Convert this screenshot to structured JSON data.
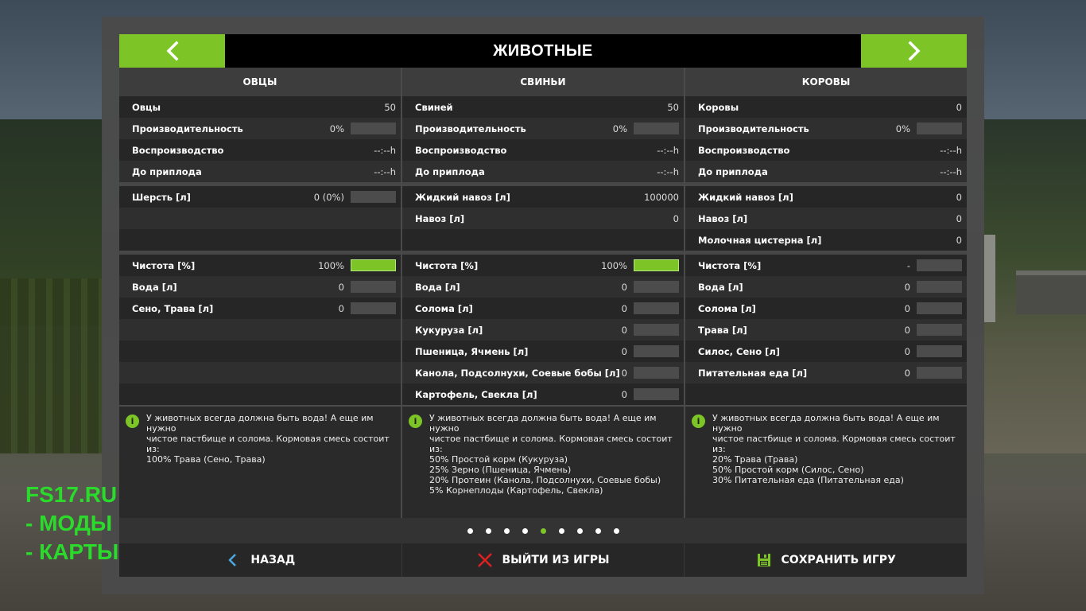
{
  "header": {
    "title": "ЖИВОТНЫЕ"
  },
  "columns": [
    {
      "name": "ОВЦЫ",
      "rows": [
        {
          "label": "Овцы",
          "value": "50",
          "bar": null
        },
        {
          "label": "Производительность",
          "value": "0%",
          "bar": 0
        },
        {
          "label": "Воспроизводство",
          "value": "--:--h",
          "bar": null
        },
        {
          "label": "До приплода",
          "value": "--:--h",
          "bar": null
        },
        {
          "sep": true
        },
        {
          "label": "Шерсть [л]",
          "value": "0 (0%)",
          "bar": 0
        },
        {
          "label": "",
          "value": "",
          "bar": null
        },
        {
          "label": "",
          "value": "",
          "bar": null
        },
        {
          "sep": true
        },
        {
          "label": "Чистота [%]",
          "value": "100%",
          "bar": 1
        },
        {
          "label": "Вода [л]",
          "value": "0",
          "bar": 0
        },
        {
          "label": "Сено, Трава [л]",
          "value": "0",
          "bar": 0
        },
        {
          "label": "",
          "value": "",
          "bar": null
        },
        {
          "label": "",
          "value": "",
          "bar": null
        },
        {
          "label": "",
          "value": "",
          "bar": null
        },
        {
          "label": "",
          "value": "",
          "bar": null
        }
      ],
      "info": "У животных всегда должна быть вода! А еще им нужно\nчистое пастбище и солома. Кормовая смесь состоит\nиз:\n100% Трава (Сено, Трава)"
    },
    {
      "name": "СВИНЬИ",
      "rows": [
        {
          "label": "Свиней",
          "value": "50",
          "bar": null
        },
        {
          "label": "Производительность",
          "value": "0%",
          "bar": 0
        },
        {
          "label": "Воспроизводство",
          "value": "--:--h",
          "bar": null
        },
        {
          "label": "До приплода",
          "value": "--:--h",
          "bar": null
        },
        {
          "sep": true
        },
        {
          "label": "Жидкий навоз [л]",
          "value": "100000",
          "bar": null
        },
        {
          "label": "Навоз [л]",
          "value": "0",
          "bar": null
        },
        {
          "label": "",
          "value": "",
          "bar": null
        },
        {
          "sep": true
        },
        {
          "label": "Чистота [%]",
          "value": "100%",
          "bar": 1
        },
        {
          "label": "Вода [л]",
          "value": "0",
          "bar": 0
        },
        {
          "label": "Солома [л]",
          "value": "0",
          "bar": 0
        },
        {
          "label": "Кукуруза [л]",
          "value": "0",
          "bar": 0
        },
        {
          "label": "Пшеница, Ячмень [л]",
          "value": "0",
          "bar": 0
        },
        {
          "label": "Канола, Подсолнухи, Соевые бобы [л]",
          "value": "0",
          "bar": 0
        },
        {
          "label": "Картофель, Свекла [л]",
          "value": "0",
          "bar": 0
        }
      ],
      "info": "У животных всегда должна быть вода! А еще им нужно\nчистое пастбище и солома. Кормовая смесь состоит\nиз:\n50% Простой корм (Кукуруза)\n25% Зерно (Пшеница, Ячмень)\n20% Протеин (Канола, Подсолнухи, Соевые бобы)\n5% Корнеплоды (Картофель, Свекла)"
    },
    {
      "name": "КОРОВЫ",
      "rows": [
        {
          "label": "Коровы",
          "value": "0",
          "bar": null
        },
        {
          "label": "Производительность",
          "value": "0%",
          "bar": 0
        },
        {
          "label": "Воспроизводство",
          "value": "--:--h",
          "bar": null
        },
        {
          "label": "До приплода",
          "value": "--:--h",
          "bar": null
        },
        {
          "sep": true
        },
        {
          "label": "Жидкий навоз [л]",
          "value": "0",
          "bar": null
        },
        {
          "label": "Навоз [л]",
          "value": "0",
          "bar": null
        },
        {
          "label": "Молочная цистерна [л]",
          "value": "0",
          "bar": null
        },
        {
          "sep": true
        },
        {
          "label": "Чистота [%]",
          "value": "-",
          "bar": 0
        },
        {
          "label": "Вода [л]",
          "value": "0",
          "bar": 0
        },
        {
          "label": "Солома [л]",
          "value": "0",
          "bar": 0
        },
        {
          "label": "Трава [л]",
          "value": "0",
          "bar": 0
        },
        {
          "label": "Силос, Сено [л]",
          "value": "0",
          "bar": 0
        },
        {
          "label": "Питательная еда [л]",
          "value": "0",
          "bar": 0
        },
        {
          "label": "",
          "value": "",
          "bar": null
        }
      ],
      "info": "У животных всегда должна быть вода! А еще им нужно\nчистое пастбище и солома. Кормовая смесь состоит\nиз:\n20% Трава (Трава)\n50% Простой корм (Силос, Сено)\n30% Питательная еда (Питательная еда)"
    }
  ],
  "pagination": {
    "count": 9,
    "active": 4
  },
  "footer": {
    "back_label": "НАЗАД",
    "quit_label": "ВЫЙТИ ИЗ ИГРЫ",
    "save_label": "СОХРАНИТЬ ИГРУ"
  },
  "watermark": {
    "line1": "FS17.RU",
    "line2": "- МОДЫ",
    "line3": "- КАРТЫ"
  },
  "colors": {
    "accent": "#7dc526",
    "quit": "#e02020",
    "watermark": "#2bdb2b"
  }
}
